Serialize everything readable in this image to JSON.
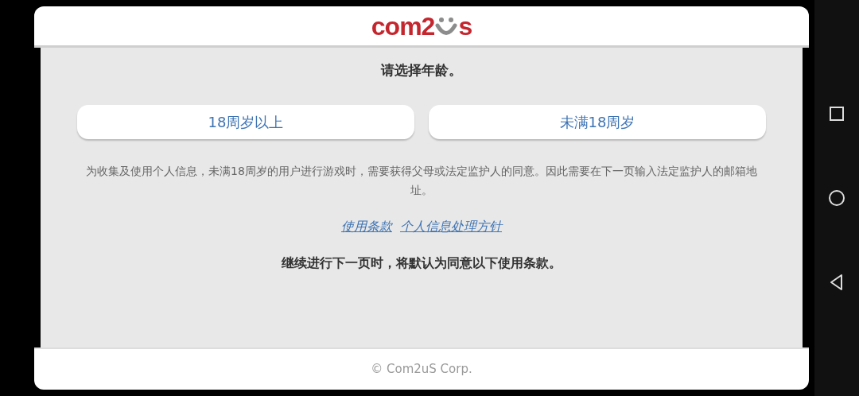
{
  "header": {
    "logo_start": "com2",
    "logo_end": "s"
  },
  "prompt": "请选择年龄。",
  "age_buttons": [
    {
      "label": "18周岁以上"
    },
    {
      "label": "未满18周岁"
    }
  ],
  "notice": "为收集及使用个人信息，未满18周岁的用户进行游戏时，需要获得父母或法定监护人的同意。因此需要在下一页输入法定监护人的邮箱地址。",
  "links": [
    {
      "label": "使用条款"
    },
    {
      "label": "个人信息处理方针"
    }
  ],
  "consent": "继续进行下一页时，将默认为同意以下使用条款。",
  "footer": "© Com2uS Corp.",
  "nav_bar": {
    "buttons": [
      {
        "kind": "recents"
      },
      {
        "kind": "home"
      },
      {
        "kind": "back"
      }
    ]
  }
}
